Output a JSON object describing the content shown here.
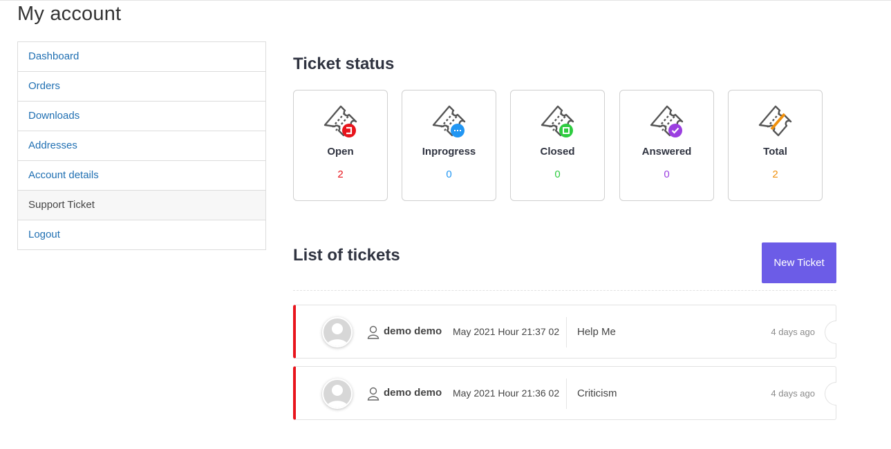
{
  "page": {
    "title": "My account"
  },
  "sidebar": {
    "items": [
      {
        "label": "Dashboard"
      },
      {
        "label": "Orders"
      },
      {
        "label": "Downloads"
      },
      {
        "label": "Addresses"
      },
      {
        "label": "Account details"
      },
      {
        "label": "Support Ticket",
        "active": true
      },
      {
        "label": "Logout"
      }
    ]
  },
  "ticket_status": {
    "title": "Ticket status",
    "cards": [
      {
        "label": "Open",
        "count": "2",
        "color": "#e8141c",
        "icon": "ticket-open-icon"
      },
      {
        "label": "Inprogress",
        "count": "0",
        "color": "#2196f3",
        "icon": "ticket-inprogress-icon"
      },
      {
        "label": "Closed",
        "count": "0",
        "color": "#2ecc40",
        "icon": "ticket-closed-icon"
      },
      {
        "label": "Answered",
        "count": "0",
        "color": "#9b3fe0",
        "icon": "ticket-answered-icon"
      },
      {
        "label": "Total",
        "count": "2",
        "color": "#f0900c",
        "icon": "ticket-total-icon"
      }
    ]
  },
  "tickets": {
    "title": "List of tickets",
    "new_button_label": "New Ticket",
    "accent_color": "#6c5ce7",
    "status_color": "#e8141c",
    "rows": [
      {
        "author": "demo demo",
        "datetime": "May 2021 Hour 21:37 02",
        "subject": "Help Me",
        "ago": "4 days ago"
      },
      {
        "author": "demo demo",
        "datetime": "May 2021 Hour 21:36 02",
        "subject": "Criticism",
        "ago": "4 days ago"
      }
    ]
  }
}
